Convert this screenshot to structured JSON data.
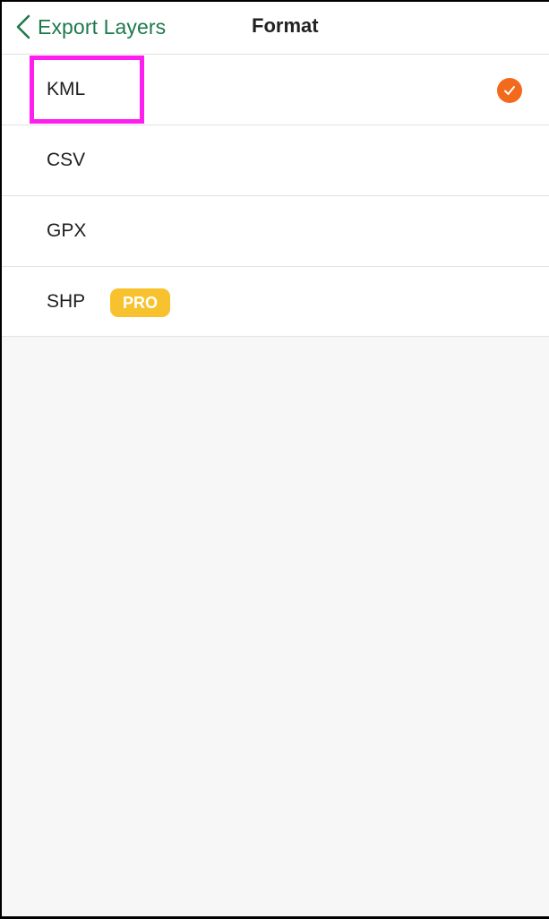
{
  "nav": {
    "back_label": "Export Layers",
    "title": "Format"
  },
  "formats": [
    {
      "label": "KML",
      "selected": true
    },
    {
      "label": "CSV",
      "selected": false
    },
    {
      "label": "GPX",
      "selected": false
    },
    {
      "label": "SHP",
      "selected": false,
      "badge": "PRO"
    }
  ],
  "colors": {
    "accent_green": "#1e7a4d",
    "check_orange": "#f26a1b",
    "pro_yellow": "#f7c22e",
    "highlight_magenta": "#ff1ef0"
  },
  "icons": {
    "back": "chevron-left-icon",
    "selected": "checkmark-circle-icon"
  }
}
